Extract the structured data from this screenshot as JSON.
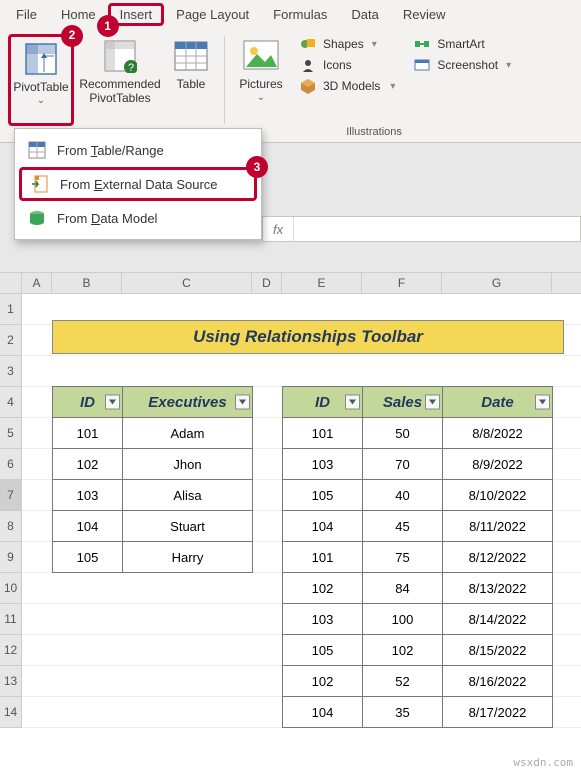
{
  "tabs": {
    "file": "File",
    "home": "Home",
    "insert": "Insert",
    "page_layout": "Page Layout",
    "formulas": "Formulas",
    "data": "Data",
    "review": "Review"
  },
  "ribbon": {
    "pivot": "PivotTable",
    "recommended": "Recommended PivotTables",
    "table": "Table",
    "pictures": "Pictures",
    "shapes": "Shapes",
    "icons": "Icons",
    "models": "3D Models",
    "smartart": "SmartArt",
    "screenshot": "Screenshot",
    "illustrations_group": "Illustrations"
  },
  "dropdown": {
    "item1": "From Table/Range",
    "item2": "From External Data Source",
    "item3": "From Data Model"
  },
  "callouts": {
    "c1": "1",
    "c2": "2",
    "c3": "3"
  },
  "fx": {
    "label": "fx",
    "value": ""
  },
  "sheet": {
    "cols": [
      "A",
      "B",
      "C",
      "D",
      "E",
      "F",
      "G"
    ],
    "rows": [
      "1",
      "2",
      "3",
      "4",
      "5",
      "6",
      "7",
      "8",
      "9",
      "10",
      "11",
      "12",
      "13",
      "14"
    ],
    "title": "Using Relationships Toolbar",
    "table1": {
      "headers": [
        "ID",
        "Executives"
      ],
      "rows": [
        [
          "101",
          "Adam"
        ],
        [
          "102",
          "Jhon"
        ],
        [
          "103",
          "Alisa"
        ],
        [
          "104",
          "Stuart"
        ],
        [
          "105",
          "Harry"
        ]
      ]
    },
    "table2": {
      "headers": [
        "ID",
        "Sales",
        "Date"
      ],
      "rows": [
        [
          "101",
          "50",
          "8/8/2022"
        ],
        [
          "103",
          "70",
          "8/9/2022"
        ],
        [
          "105",
          "40",
          "8/10/2022"
        ],
        [
          "104",
          "45",
          "8/11/2022"
        ],
        [
          "101",
          "75",
          "8/12/2022"
        ],
        [
          "102",
          "84",
          "8/13/2022"
        ],
        [
          "103",
          "100",
          "8/14/2022"
        ],
        [
          "105",
          "102",
          "8/15/2022"
        ],
        [
          "102",
          "52",
          "8/16/2022"
        ],
        [
          "104",
          "35",
          "8/17/2022"
        ]
      ]
    }
  },
  "watermark": "wsxdn.com"
}
